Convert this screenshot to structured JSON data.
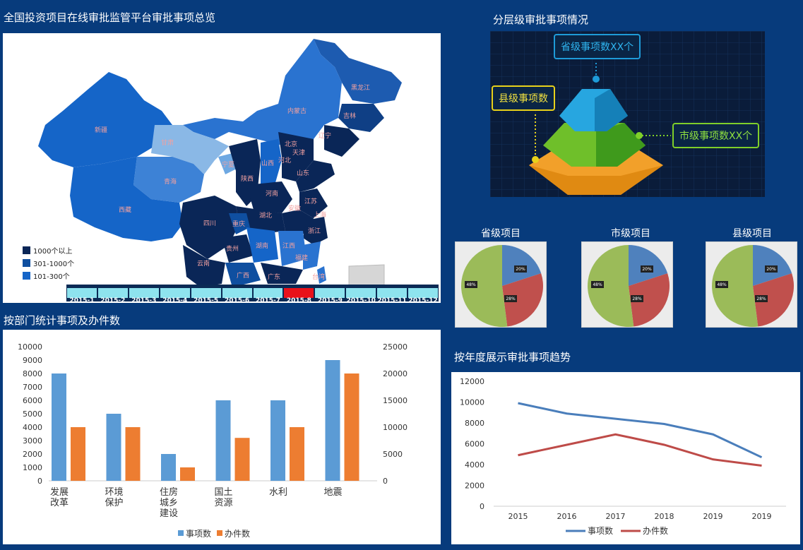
{
  "titles": {
    "map": "全国投资项目在线审批监管平台审批事项总览",
    "pyramid": "分层级审批事项情况",
    "bar": "按部门统计事项及办件数",
    "line": "按年度展示审批事项趋势"
  },
  "map": {
    "legend": [
      {
        "label": "1000个以上",
        "color": "#0a2657"
      },
      {
        "label": "301-1000个",
        "color": "#0f4fa0"
      },
      {
        "label": "101-300个",
        "color": "#1565c8"
      }
    ],
    "provinces": [
      "黑龙江",
      "吉林",
      "辽宁",
      "内蒙古",
      "新疆",
      "甘肃",
      "青海",
      "西藏",
      "宁夏",
      "陕西",
      "山西",
      "河北",
      "北京",
      "天津",
      "山东",
      "河南",
      "湖北",
      "安徽",
      "江苏",
      "上海",
      "浙江",
      "四川",
      "重庆",
      "贵州",
      "湖南",
      "江西",
      "福建",
      "云南",
      "广西",
      "广东",
      "台湾"
    ],
    "timeline": [
      "2015-1",
      "2015-2",
      "2015-3",
      "2015-4",
      "2015-5",
      "2015-6",
      "2015-7",
      "2015-8",
      "2015-9",
      "2015-10",
      "2015-11",
      "2015-12"
    ],
    "timeline_active": "2015-8"
  },
  "pyramid": {
    "top_label": "省级事项数XX个",
    "left_label": "县级事项数",
    "right_label": "市级事项数XX个"
  },
  "pies": [
    {
      "title": "省级项目"
    },
    {
      "title": "市级项目"
    },
    {
      "title": "县级项目"
    }
  ],
  "pie_slice_labels": [
    "20%",
    "28%",
    "48%"
  ],
  "chart_data": [
    {
      "type": "bar",
      "categories": [
        "发展改革",
        "环境保护",
        "住房城乡建设",
        "国土资源",
        "水利",
        "地震"
      ],
      "category_lines": [
        [
          "发展",
          "改革"
        ],
        [
          "环境",
          "保护"
        ],
        [
          "住房",
          "城乡",
          "建设"
        ],
        [
          "国土",
          "资源"
        ],
        [
          "水利"
        ],
        [
          "地震"
        ]
      ],
      "series": [
        {
          "name": "事项数",
          "axis": "left",
          "values": [
            8000,
            5000,
            2000,
            6000,
            6000,
            9000
          ],
          "color": "#5b9bd5"
        },
        {
          "name": "办件数",
          "axis": "right",
          "values": [
            10000,
            10000,
            2500,
            8000,
            10000,
            20000
          ],
          "color": "#ed7d31"
        }
      ],
      "ylim": [
        0,
        10000
      ],
      "yticks": [
        0,
        1000,
        2000,
        3000,
        4000,
        5000,
        6000,
        7000,
        8000,
        9000,
        10000
      ],
      "y2lim": [
        0,
        25000
      ],
      "y2ticks": [
        0,
        5000,
        10000,
        15000,
        20000,
        25000
      ]
    },
    {
      "type": "line",
      "x": [
        "2015",
        "2016",
        "2017",
        "2018",
        "2019",
        "2019"
      ],
      "series": [
        {
          "name": "事项数",
          "values": [
            9900,
            8900,
            8400,
            7900,
            6900,
            4700
          ],
          "color": "#4a7ebb"
        },
        {
          "name": "办件数",
          "values": [
            4900,
            5900,
            6900,
            5900,
            4500,
            3900
          ],
          "color": "#be4b48"
        }
      ],
      "ylim": [
        0,
        12000
      ],
      "yticks": [
        0,
        2000,
        4000,
        6000,
        8000,
        10000,
        12000
      ]
    },
    {
      "type": "pie",
      "slices": [
        {
          "label": "20%",
          "value": 20,
          "color": "#4f81bd"
        },
        {
          "label": "28%",
          "value": 28,
          "color": "#c0504d"
        },
        {
          "label": "48%",
          "value": 52,
          "color": "#9bbb59"
        }
      ]
    }
  ]
}
